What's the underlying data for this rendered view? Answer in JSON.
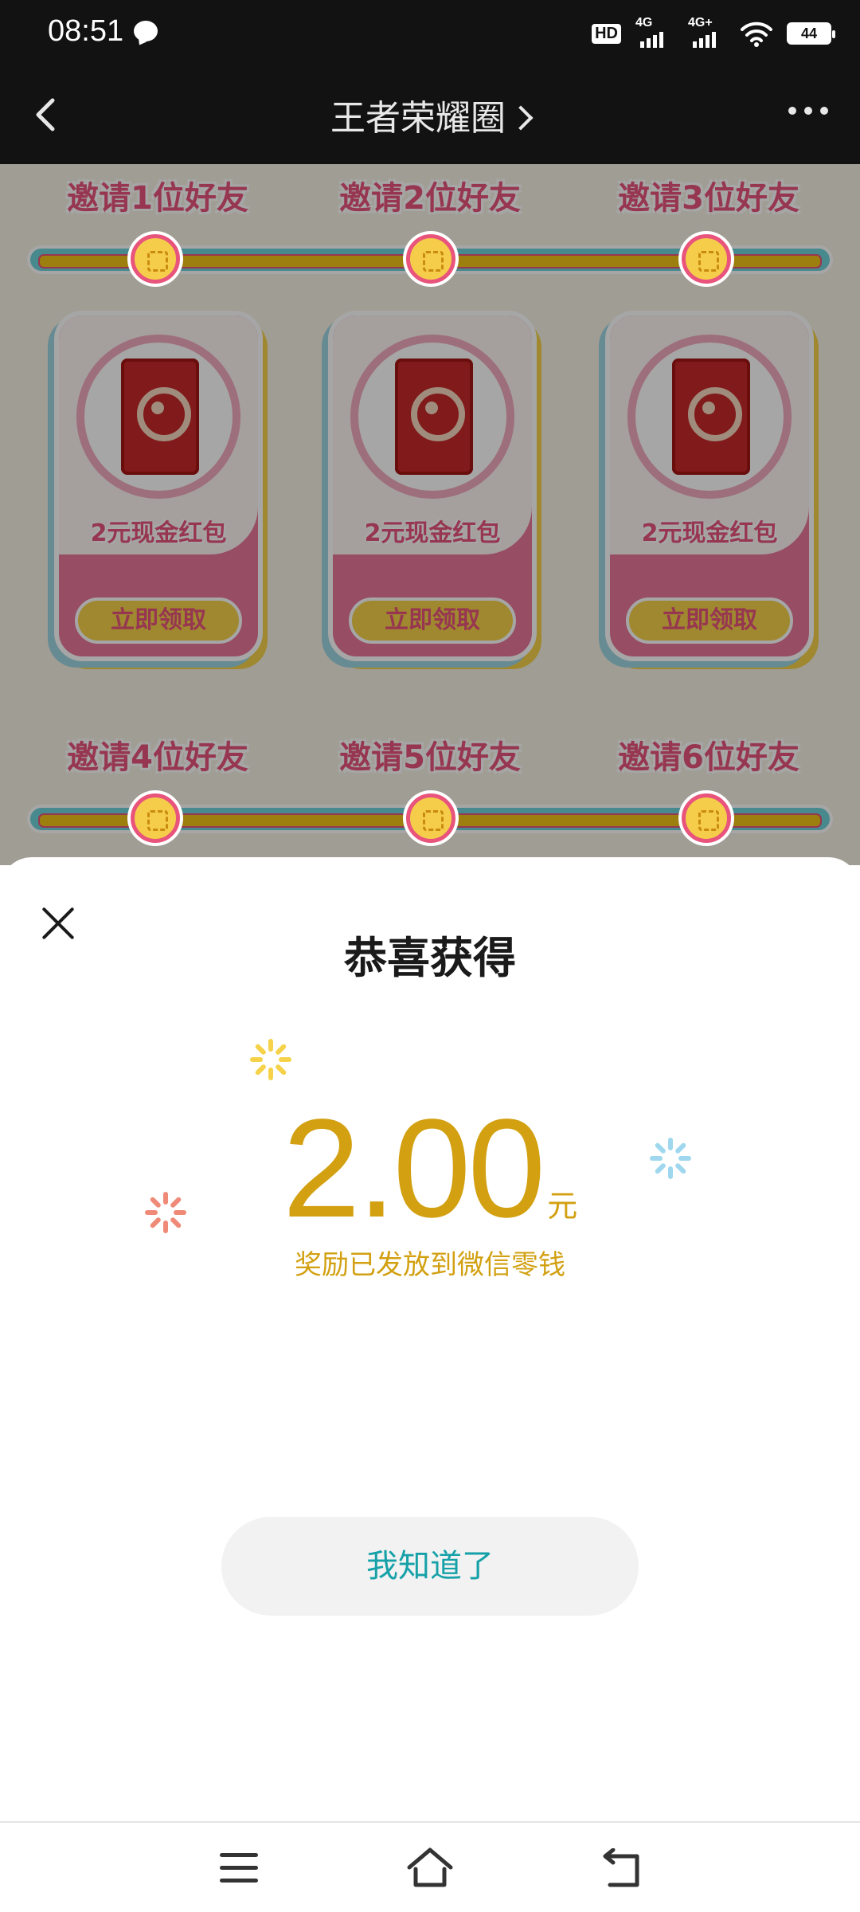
{
  "status_bar": {
    "time": "08:51",
    "hd_label": "HD",
    "net1_label": "4G",
    "net2_label": "4G+",
    "battery": "44",
    "icons": [
      "chat-bubble-icon",
      "hd-icon",
      "signal-icon",
      "signal-icon",
      "wifi-icon",
      "battery-icon"
    ]
  },
  "header": {
    "title": "王者荣耀圈",
    "icons": [
      "back-arrow-icon",
      "chevron-right-icon",
      "more-icon"
    ]
  },
  "background": {
    "invite_labels": [
      "邀请1位好友",
      "邀请2位好友",
      "邀请3位好友",
      "邀请4位好友",
      "邀请5位好友",
      "邀请6位好友"
    ],
    "reward_cards": [
      {
        "amount": "2元现金红包",
        "button": "立即领取"
      },
      {
        "amount": "2元现金红包",
        "button": "立即领取"
      },
      {
        "amount": "2元现金红包",
        "button": "立即领取"
      }
    ]
  },
  "dialog": {
    "title": "恭喜获得",
    "amount": "2.00",
    "unit": "元",
    "subtitle": "奖励已发放到微信零钱",
    "confirm_label": "我知道了",
    "colors": {
      "amount": "#d2a010",
      "button_text": "#16a1a8",
      "sparkle_yellow": "#f5d24a",
      "sparkle_blue": "#9fd8ee",
      "sparkle_red": "#f08a78"
    }
  },
  "nav_bar": {
    "icons": [
      "menu-icon",
      "home-icon",
      "back-icon"
    ]
  }
}
